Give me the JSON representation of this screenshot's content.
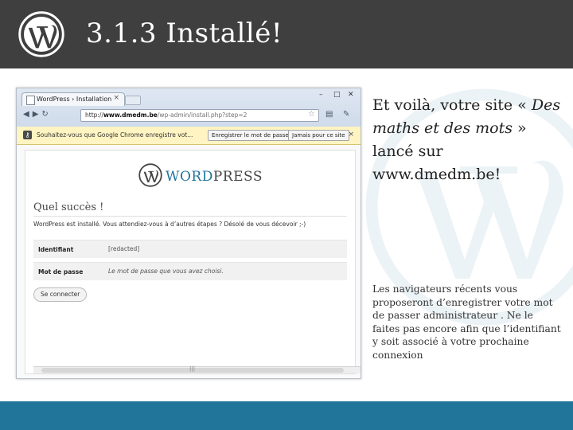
{
  "slide": {
    "title": "3.1.3 Installé!",
    "main_text_parts": {
      "pre": "Et voilà, votre site « ",
      "italic": "Des maths et des mots",
      "post": " » lancé sur www.dmedm.be!"
    },
    "note": "Les navigateurs récents vous proposeront d’enregistrer votre mot de passer administrateur . Ne le faites pas encore afin que l’identifiant y soit associé à votre prochaine connexion"
  },
  "browser": {
    "tab_title": "WordPress › Installation",
    "tab_close": "×",
    "window_controls": [
      "–",
      "□",
      "✕"
    ],
    "url": {
      "scheme": "http://",
      "host": "www.dmedm.be",
      "path": "/wp-admin/install.php?step=2"
    },
    "nav_icons": [
      "back-icon",
      "forward-icon",
      "reload-icon"
    ],
    "infobar": {
      "text": "Souhaitez-vous que Google Chrome enregistre vot...",
      "save_button": "Enregistrer le mot de passe",
      "never_button": "Jamais pour ce site",
      "close": "×"
    }
  },
  "wp_page": {
    "wordmark_a": "WORD",
    "wordmark_b": "PRESS",
    "success_title": "Quel succès !",
    "success_message": "WordPress est installé. Vous attendiez-vous à d’autres étapes ? Désolé de vous décevoir ;-)",
    "rows": [
      {
        "label": "Identifiant",
        "value": "[redacted]"
      },
      {
        "label": "Mot de passe",
        "value": "Le mot de passe que vous avez choisi."
      }
    ],
    "login_button": "Se connecter"
  },
  "colors": {
    "header_bg": "#3f3f3f",
    "footer_bg": "#21759b",
    "wp_blue": "#21759b"
  }
}
